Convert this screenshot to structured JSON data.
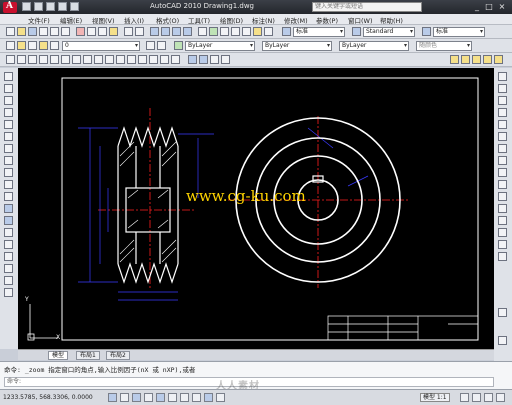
{
  "window": {
    "title": "AutoCAD 2010   Drawing1.dwg",
    "search_placeholder": "键入关键字或短语",
    "minimize": "_",
    "maximize": "□",
    "close": "×"
  },
  "menu": [
    "文件(F)",
    "编辑(E)",
    "视图(V)",
    "插入(I)",
    "格式(O)",
    "工具(T)",
    "绘图(D)",
    "标注(N)",
    "修改(M)",
    "参数(P)",
    "窗口(W)",
    "帮助(H)"
  ],
  "toolbars": {
    "workspace": "Standard",
    "dim_style": "标准",
    "style_combo": "标准",
    "layer_combo": "0",
    "linetype_combo": "ByLayer",
    "lineweight_combo": "ByLayer",
    "color_combo": "ByLayer",
    "plot_style": "随颜色"
  },
  "drawing": {
    "watermark_text": "www.cg-ku.com",
    "ucs_y": "Y",
    "ucs_x": "X"
  },
  "layout_tabs": [
    "模型",
    "布局1",
    "布局2"
  ],
  "command": {
    "history": "命令: _zoom 指定窗口的角点,输入比例因子(nX 或 nXP),或者",
    "prompt": "命令:"
  },
  "status": {
    "coordinates": "1233.5785, 568.3306, 0.0000",
    "model_label": "模型 1:1",
    "watermark_logo": "人人素材"
  },
  "colors": {
    "title_bg": "#2a2d33",
    "drawing_bg": "#000000",
    "geometry": "#ffffff",
    "dimension": "#2a2aff",
    "centerline": "#ff2020",
    "watermark": "#ffd400"
  }
}
